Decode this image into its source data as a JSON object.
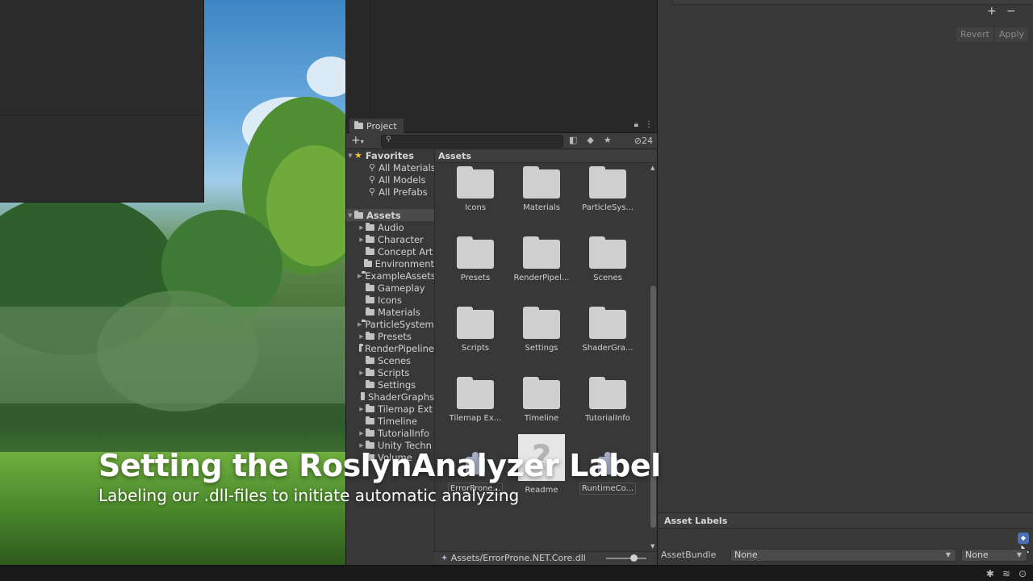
{
  "project_window": {
    "tab_label": "Project",
    "hidden_count": "24",
    "favorites": {
      "label": "Favorites",
      "items": [
        "All Materials",
        "All Models",
        "All Prefabs"
      ]
    },
    "assets_root": "Assets",
    "tree_items": [
      "Audio",
      "Character",
      "Concept Art",
      "Environment",
      "ExampleAssets",
      "Gameplay",
      "Icons",
      "Materials",
      "ParticleSystems",
      "Presets",
      "RenderPipeline",
      "Scenes",
      "Scripts",
      "Settings",
      "ShaderGraphs",
      "Tilemap Ext",
      "Timeline",
      "TutorialInfo",
      "Unity Techn",
      "Volume"
    ],
    "grid_header": "Assets",
    "grid_items": [
      {
        "label": "Icons"
      },
      {
        "label": "Materials"
      },
      {
        "label": "ParticleSys..."
      },
      {
        "label": "Presets"
      },
      {
        "label": "RenderPipel..."
      },
      {
        "label": "Scenes"
      },
      {
        "label": "Scripts"
      },
      {
        "label": "Settings"
      },
      {
        "label": "ShaderGra..."
      },
      {
        "label": "Tilemap Ex..."
      },
      {
        "label": "Timeline"
      },
      {
        "label": "TutorialInfo"
      },
      {
        "label": "ErrorProne..."
      },
      {
        "label": "Readme"
      },
      {
        "label": "RuntimeCo..."
      }
    ],
    "path": "Assets/ErrorProne.NET.Core.dll"
  },
  "inspector": {
    "plus": "+",
    "minus": "−",
    "revert_label": "Revert",
    "apply_label": "Apply",
    "asset_labels_header": "Asset Labels",
    "asset_bundle_label": "AssetBundle",
    "asset_bundle_value": "None",
    "asset_bundle_variant": "None"
  },
  "overlay": {
    "title": "Setting the RoslynAnalyzer Label",
    "subtitle": "Labeling our .dll-files to initiate automatic analyzing"
  },
  "icons": [
    "folder-icon",
    "lock-icon",
    "kebab-menu-icon",
    "plus-icon",
    "search-icon",
    "filter-icon",
    "label-icon",
    "star-icon",
    "eye-hidden-icon",
    "puzzle-icon",
    "question-icon",
    "tag-icon",
    "bug-icon",
    "layers-icon",
    "check-icon"
  ],
  "colors": {
    "accent_tag": "#4a6fb5",
    "star": "#f2c232",
    "dll_icon": "#a6afc6"
  }
}
